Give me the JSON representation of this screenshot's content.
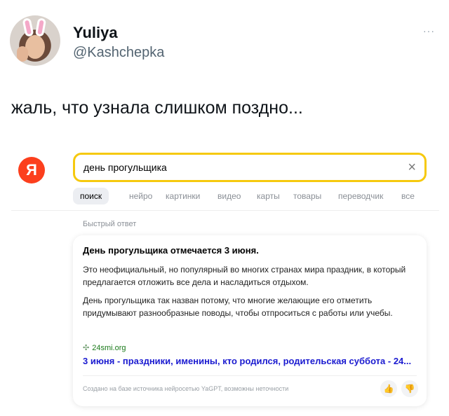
{
  "tweet": {
    "name": "Yuliya",
    "handle": "@Kashchepka",
    "more": "···",
    "text": "жаль, что узнала слишком поздно..."
  },
  "search": {
    "logo": "Я",
    "query": "день прогульщика",
    "clear": "×",
    "tabs": [
      "поиск",
      "нейро",
      "картинки",
      "видео",
      "карты",
      "товары",
      "переводчик",
      "все"
    ]
  },
  "answer": {
    "label": "Быстрый ответ",
    "title": "День прогульщика отмечается 3 июня.",
    "paragraph1": "Это неофициальный, но популярный во многих странах мира праздник, в который предлагается отложить все дела и насладиться отдыхом.",
    "paragraph2": "День прогульщика так назван потому, что многие желающие его отметить придумывают разнообразные поводы, чтобы отпроситься с работы или учебы.",
    "source_domain": "24smi.org",
    "source_title": "3 июня - праздники, именины, кто родился, родительская суббота - 24...",
    "disclaimer": "Создано на базе источника нейросетью YaGPT, возможны неточности"
  }
}
